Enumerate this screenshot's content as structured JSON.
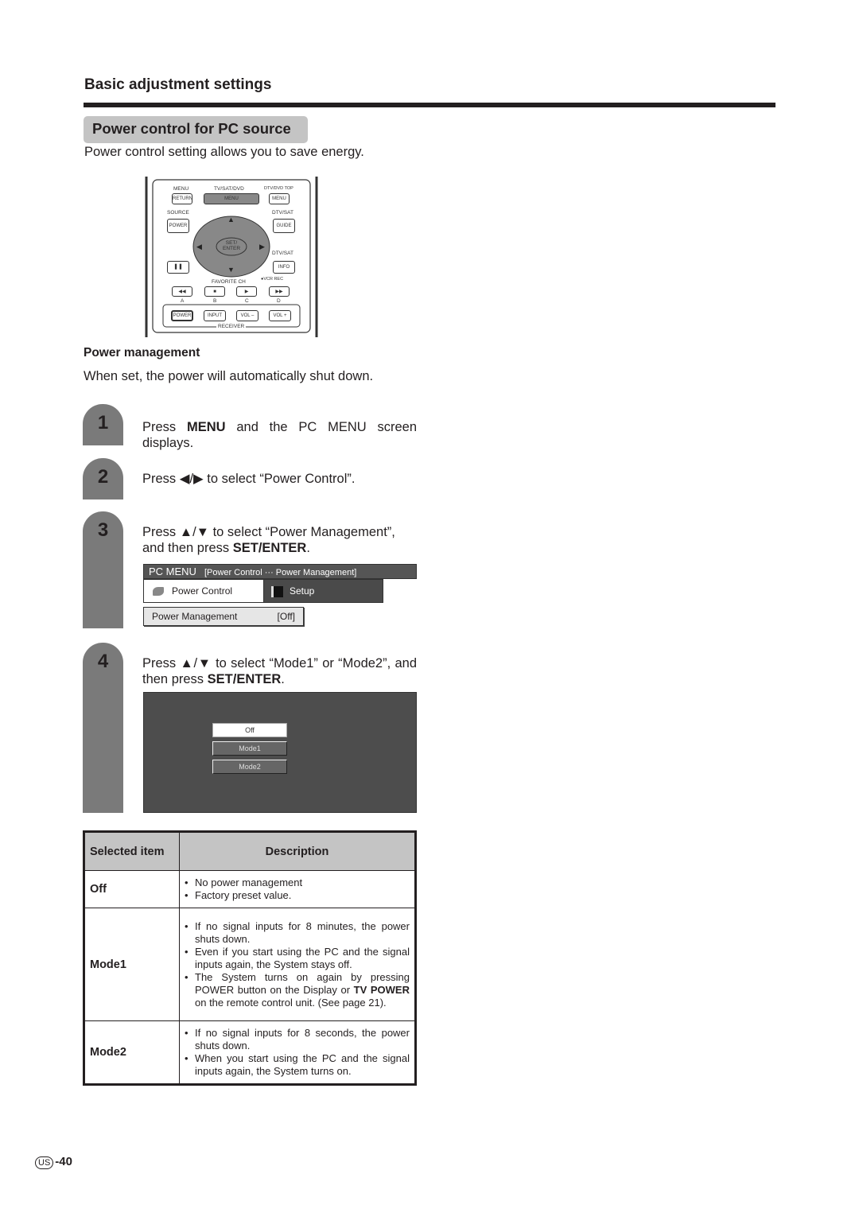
{
  "section_title": "Basic adjustment settings",
  "subheading": "Power control for PC source",
  "intro": "Power control setting allows you to save energy.",
  "remote": {
    "top_labels": [
      "MENU",
      "TV/SAT/DVD",
      "DTV/DVD TOP"
    ],
    "return_btn": "RETURN",
    "menu_btn": "MENU",
    "menu_btn2": "MENU",
    "source_label": "SOURCE",
    "dtvsat_label": "DTV/SAT",
    "power_btn": "POWER",
    "guide_btn": "GUIDE",
    "set_enter": "SET/ ENTER",
    "dtvsat_label2": "DTV/SAT",
    "info_btn": "INFO",
    "favorite": "FAVORITE CH",
    "vcr_rec": "●VCR REC",
    "abcd": [
      "A",
      "B",
      "C",
      "D"
    ],
    "receiver_btns": [
      "POWER",
      "INPUT",
      "VOL –",
      "VOL +"
    ],
    "receiver_label": "RECEIVER",
    "icons": {
      "up": "▲",
      "down": "▼",
      "left": "◀",
      "right": "▶",
      "pause": "❚❚",
      "rew": "◀◀",
      "stop": "■",
      "play": "▶",
      "ff": "▶▶"
    }
  },
  "power_management": {
    "heading": "Power management",
    "text": "When set, the power will automatically shut down."
  },
  "steps": [
    {
      "num": "1",
      "pre": "Press ",
      "bold": "MENU",
      "post": " and the PC MENU screen displays."
    },
    {
      "num": "2",
      "text": "Press ◀/▶ to select “Power Control”."
    },
    {
      "num": "3",
      "pre": "Press ▲/▼ to select “Power Management”, and then press ",
      "bold": "SET/ENTER",
      "post": "."
    },
    {
      "num": "4",
      "pre": "Press ▲/▼ to select “Mode1” or “Mode2”, and then press ",
      "bold": "SET/ENTER",
      "post": "."
    }
  ],
  "pc_menu": {
    "title": "PC MENU",
    "breadcrumb": "[Power Control ··· Power Management]",
    "tab_power_control": "Power Control",
    "tab_setup": "Setup",
    "item_label": "Power Management",
    "item_value": "[Off]"
  },
  "mode_screen": {
    "options": [
      "Off",
      "Mode1",
      "Mode2"
    ],
    "selected": "Off"
  },
  "table": {
    "headers": [
      "Selected item",
      "Description"
    ],
    "rows": [
      {
        "item": "Off",
        "desc": [
          "No power management",
          "Factory preset value."
        ]
      },
      {
        "item": "Mode1",
        "desc": [
          "If no signal inputs for 8 minutes, the power shuts down.",
          "Even if you start using the PC and the signal inputs again, the System stays off."
        ],
        "desc3_pre": "The System turns on again by pressing POWER button on the Display or ",
        "desc3_bold1": "TV POWER",
        "desc3_post": " on the remote control unit. (See page 21)."
      },
      {
        "item": "Mode2",
        "desc": [
          "If no signal inputs for 8 seconds, the power shuts down.",
          "When you start using the PC and the signal inputs again, the System turns on."
        ]
      }
    ]
  },
  "footer": {
    "region": "US",
    "page": "-40"
  }
}
